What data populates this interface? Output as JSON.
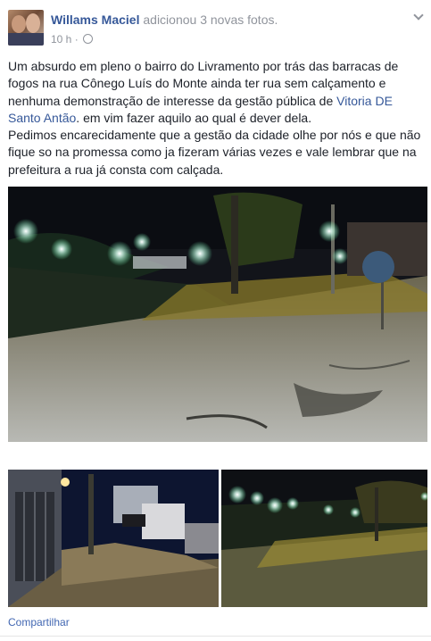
{
  "post": {
    "author": "Willams Maciel",
    "action": "adicionou 3 novas fotos.",
    "time": "10 h",
    "separator": "·",
    "privacy_icon": "globe-icon",
    "menu_icon": "chevron-down-icon",
    "text": {
      "p1_before_link": "Um absurdo em pleno o bairro do Livramento por trás das barracas de fogos na rua Cônego Luís do Monte ainda ter rua sem calçamento e nenhuma demonstração de interesse da gestão pública de ",
      "p1_link": "Vitoria DE Santo Antão",
      "p1_after_link": ". em vim fazer aquilo ao qual é dever dela.",
      "p2": "Pedimos encarecidamente que a gestão da cidade olhe por nós e que não fique so na promessa como ja fizeram várias vezes e vale lembrar que na prefeitura a rua já consta com calçada."
    },
    "photos": [
      "night-street-photo-main",
      "night-street-photo-left",
      "night-street-photo-right"
    ],
    "share_label": "Compartilhar"
  },
  "colors": {
    "link": "#365899",
    "meta": "#90949c",
    "text": "#1d2129",
    "share": "#4267b2"
  }
}
